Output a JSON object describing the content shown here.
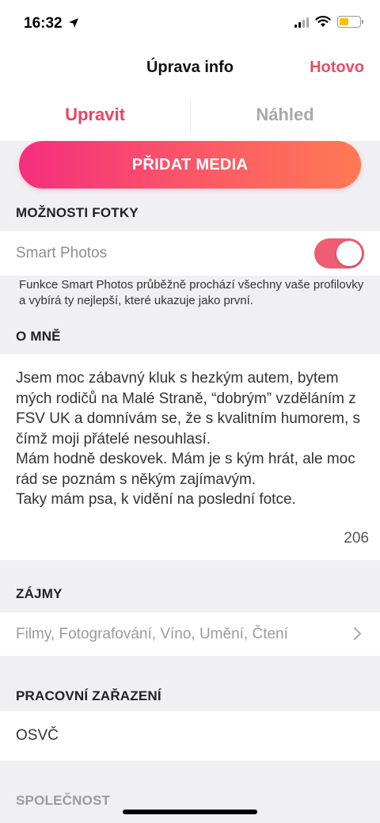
{
  "status": {
    "time": "16:32"
  },
  "nav": {
    "title": "Úprava info",
    "done": "Hotovo"
  },
  "tabs": {
    "edit": "Upravit",
    "preview": "Náhled"
  },
  "add_media": "PŘIDAT MEDIA",
  "photo_options": {
    "header": "MOŽNOSTI FOTKY",
    "smart_photos_label": "Smart Photos",
    "smart_photos_on": true,
    "note": "Funkce Smart Photos průběžně prochází všechny vaše profilovky a vybírá ty nejlepší, které ukazuje jako první."
  },
  "about": {
    "header": "O MNĚ",
    "text": "Jsem moc zábavný kluk s hezkým autem, bytem mých rodičů na Malé Straně, “dobrým” vzděláním z FSV UK a domnívám se, že s kvalitním humorem, s čímž moji přátelé nesouhlasí.\nMám hodně deskovek. Mám je s kým hrát, ale moc rád se poznám s někým zajímavým.\nTaky mám psa, k vidění na poslední fotce.",
    "char_count": "206"
  },
  "interests": {
    "header": "ZÁJMY",
    "value": "Filmy, Fotografování, Víno, Umění, Čtení"
  },
  "job": {
    "header": "PRACOVNÍ ZAŘAZENÍ",
    "value": "OSVČ"
  },
  "company": {
    "header": "SPOLEČNOST"
  },
  "colors": {
    "accent": "#e94465",
    "toggle": "#ee5d73"
  }
}
